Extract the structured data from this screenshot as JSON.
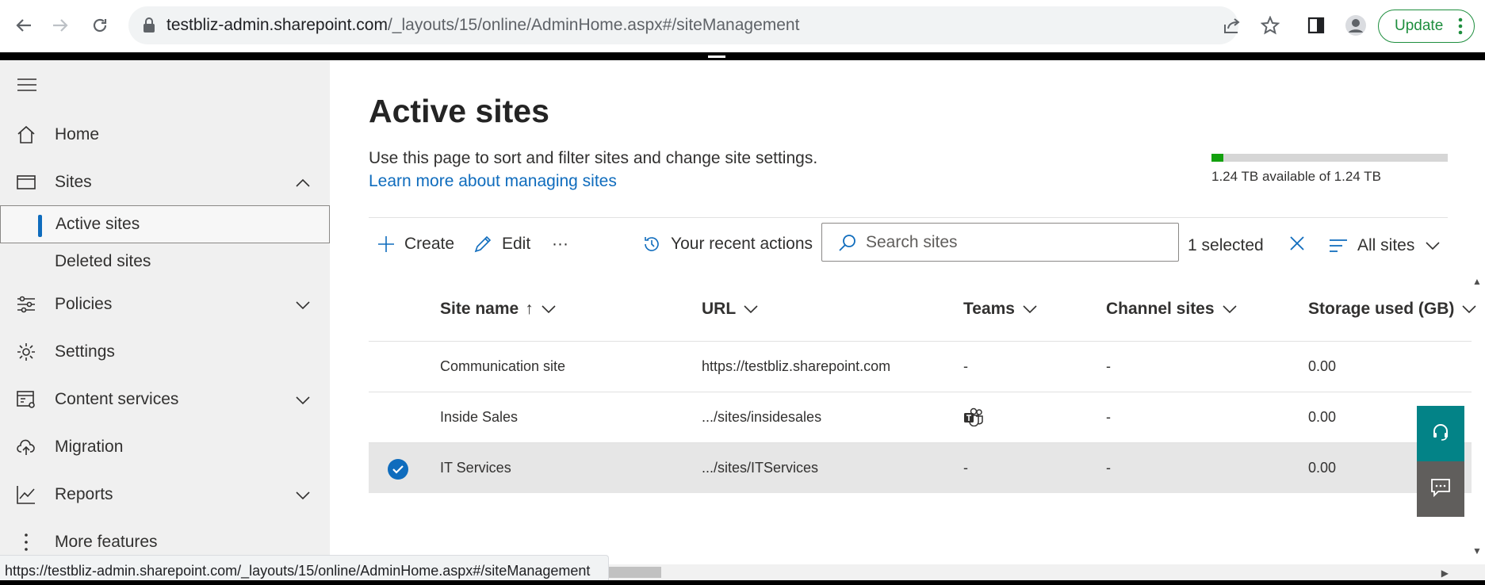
{
  "browser": {
    "url_host": "testbliz-admin.sharepoint.com",
    "url_path": "/_layouts/15/online/AdminHome.aspx#/siteManagement",
    "update_label": "Update",
    "status_url": "https://testbliz-admin.sharepoint.com/_layouts/15/online/AdminHome.aspx#/siteManagement"
  },
  "sidebar": {
    "items": [
      {
        "label": "Home",
        "icon": "home-icon"
      },
      {
        "label": "Sites",
        "icon": "sites-icon"
      },
      {
        "label": "Active sites"
      },
      {
        "label": "Deleted sites"
      },
      {
        "label": "Policies",
        "icon": "policies-icon"
      },
      {
        "label": "Settings",
        "icon": "gear-icon"
      },
      {
        "label": "Content services",
        "icon": "content-services-icon"
      },
      {
        "label": "Migration",
        "icon": "cloud-upload-icon"
      },
      {
        "label": "Reports",
        "icon": "chart-icon"
      },
      {
        "label": "More features",
        "icon": "more-vertical-icon"
      }
    ]
  },
  "main": {
    "title": "Active sites",
    "description": "Use this page to sort and filter sites and change site settings.",
    "learn_link": "Learn more about managing sites",
    "storage": {
      "text": "1.24 TB available of 1.24 TB",
      "used_fraction": 0.05,
      "fill_color": "#13a10e"
    },
    "toolbar": {
      "create": "Create",
      "edit": "Edit",
      "more": "···",
      "recent": "Your recent actions",
      "search_placeholder": "Search sites",
      "selected": "1 selected",
      "view": "All sites"
    },
    "table": {
      "columns": [
        "Site name",
        "URL",
        "Teams",
        "Channel sites",
        "Storage used (GB)"
      ],
      "sort_indicator": "↑",
      "rows": [
        {
          "name": "Communication site",
          "url": "https://testbliz.sharepoint.com",
          "teams": "-",
          "channel": "-",
          "storage": "0.00",
          "selected": false
        },
        {
          "name": "Inside Sales",
          "url": ".../sites/insidesales",
          "teams": "teams-icon",
          "channel": "-",
          "storage": "0.00",
          "selected": false
        },
        {
          "name": "IT Services",
          "url": ".../sites/ITServices",
          "teams": "-",
          "channel": "-",
          "storage": "0.00",
          "selected": true
        }
      ]
    }
  }
}
